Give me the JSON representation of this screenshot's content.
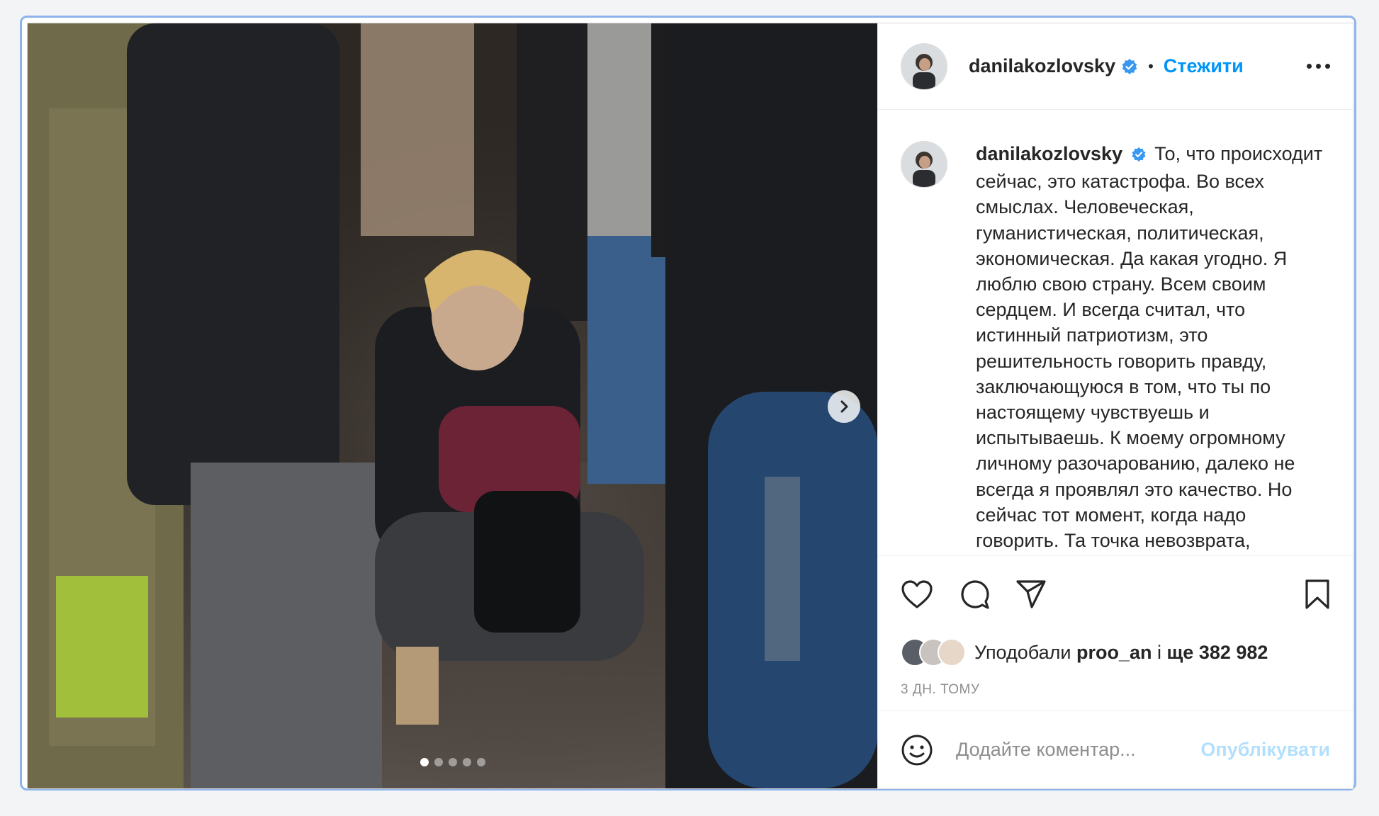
{
  "post": {
    "username": "danilakozlovsky",
    "follow_label": "Стежити",
    "separator": "•",
    "caption_text": "То, что происходит сейчас, это катастрофа. Во всех смыслах. Человеческая, гуманистическая, политическая, экономическая. Да какая угодно. Я люблю свою страну. Всем своим сердцем. И всегда считал, что истинный патриотизм, это решительность говорить правду, заключающуюся в том, что ты по настоящему чувствуешь и испытываешь. К моему огромному личному разочарованию, далеко не всегда я проявлял это качество. Но сейчас тот момент, когда надо говорить. Та точка невозврата,",
    "likes_prefix": "Уподобали",
    "likes_user": "proo_an",
    "likes_middle": "і",
    "likes_count": "ще 382 982",
    "timestamp": "3 ДН. ТОМУ",
    "comment_placeholder": "Додайте коментар...",
    "publish_label": "Опублікувати",
    "carousel": {
      "total": 5,
      "active": 1
    }
  },
  "icons": {
    "verified": "verified-badge-icon",
    "more": "more-options-icon",
    "like": "heart-icon",
    "comment": "comment-icon",
    "share": "share-icon",
    "save": "bookmark-icon",
    "next": "chevron-right-icon",
    "emoji": "emoji-icon"
  },
  "colors": {
    "accent": "#0095f6",
    "verified": "#3897f0",
    "publish_disabled": "#b2dffc"
  }
}
